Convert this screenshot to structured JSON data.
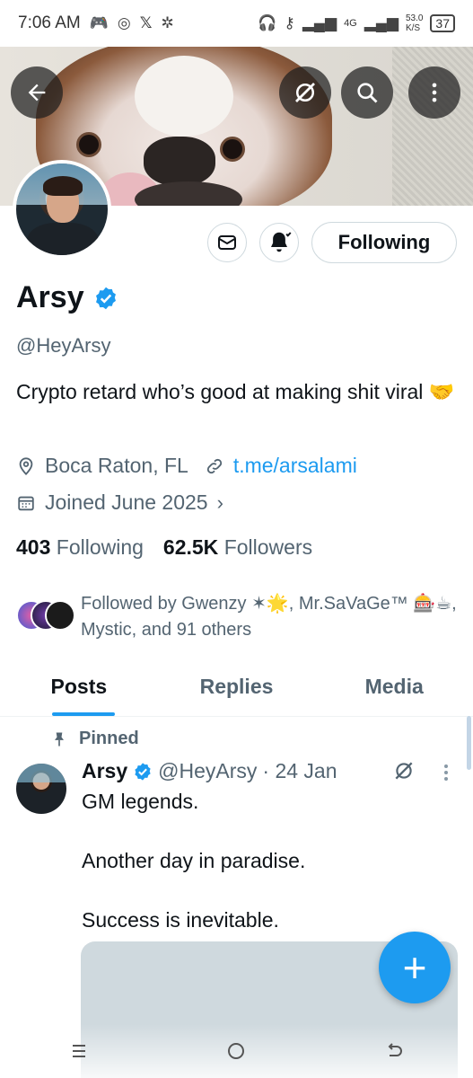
{
  "status_bar": {
    "time": "7:06 AM",
    "net_speed": "53.0",
    "net_unit": "K/S",
    "network": "4G",
    "battery": "37"
  },
  "banner": {
    "back_icon": "back-arrow-icon",
    "grok_icon": "grok-icon",
    "search_icon": "search-icon",
    "more_icon": "more-vertical-icon"
  },
  "profile": {
    "name": "Arsy",
    "handle": "@HeyArsy",
    "bio": "Crypto retard who’s good at making shit viral 🤝",
    "location": "Boca Raton, FL",
    "link": "t.me/arsalami",
    "joined": "Joined June 2025",
    "following_count": "403",
    "following_label": "Following",
    "followers_count": "62.5K",
    "followers_label": "Followers",
    "follow_button": "Following",
    "followed_by": "Followed by Gwenzy ✶🌟, Mr.SaVaGe™ 🎰☕, Mystic, and 91 others"
  },
  "tabs": [
    "Posts",
    "Replies",
    "Media"
  ],
  "post": {
    "pinned_label": "Pinned",
    "author": "Arsy",
    "handle": "@HeyArsy",
    "date": "· 24 Jan",
    "lines": [
      "GM legends.",
      "Another day in paradise.",
      "Success is inevitable."
    ]
  },
  "fab": {
    "icon": "plus-icon",
    "label": "+"
  },
  "colors": {
    "accent": "#1d9bf0",
    "text": "#0f1419",
    "secondary": "#536471"
  }
}
